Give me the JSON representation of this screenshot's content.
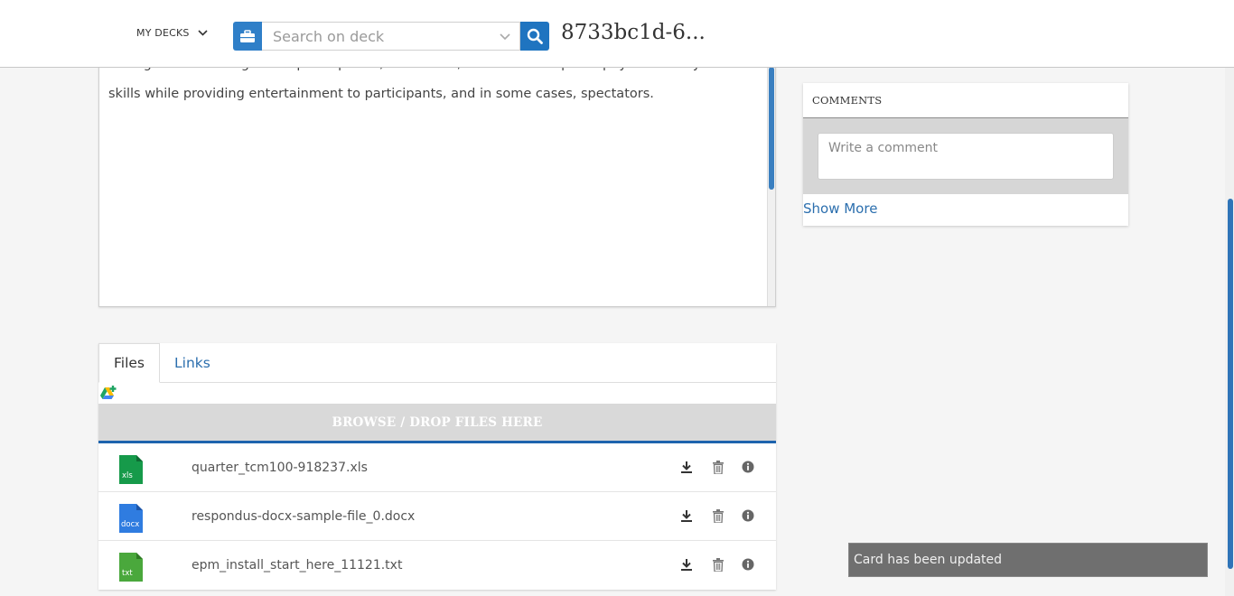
{
  "header": {
    "decks_label": "MY DECKS",
    "search_placeholder": "Search on deck",
    "deck_title": "8733bc1d-6..."
  },
  "description": {
    "lines": [
      "through casual or organized participation, aim to use, maintain or improve physical ability and",
      "skills while providing entertainment to participants, and in some cases, spectators."
    ]
  },
  "comments": {
    "heading": "COMMENTS",
    "placeholder": "Write a comment",
    "show_more": "Show More"
  },
  "attachments": {
    "tabs": [
      {
        "label": "Files",
        "active": true
      },
      {
        "label": "Links",
        "active": false
      }
    ],
    "dropzone_label": "BROWSE / DROP FILES HERE",
    "files": [
      {
        "name": "quarter_tcm100-918237.xls",
        "ext": "xls",
        "color": "#169a4a"
      },
      {
        "name": "respondus-docx-sample-file_0.docx",
        "ext": "docx",
        "color": "#2f7ce0"
      },
      {
        "name": "epm_install_start_here_11121.txt",
        "ext": "txt",
        "color": "#4aa83c"
      }
    ],
    "icons": [
      "download-icon",
      "trash-icon",
      "info-icon"
    ]
  },
  "toast": {
    "message": "Card has been updated"
  }
}
